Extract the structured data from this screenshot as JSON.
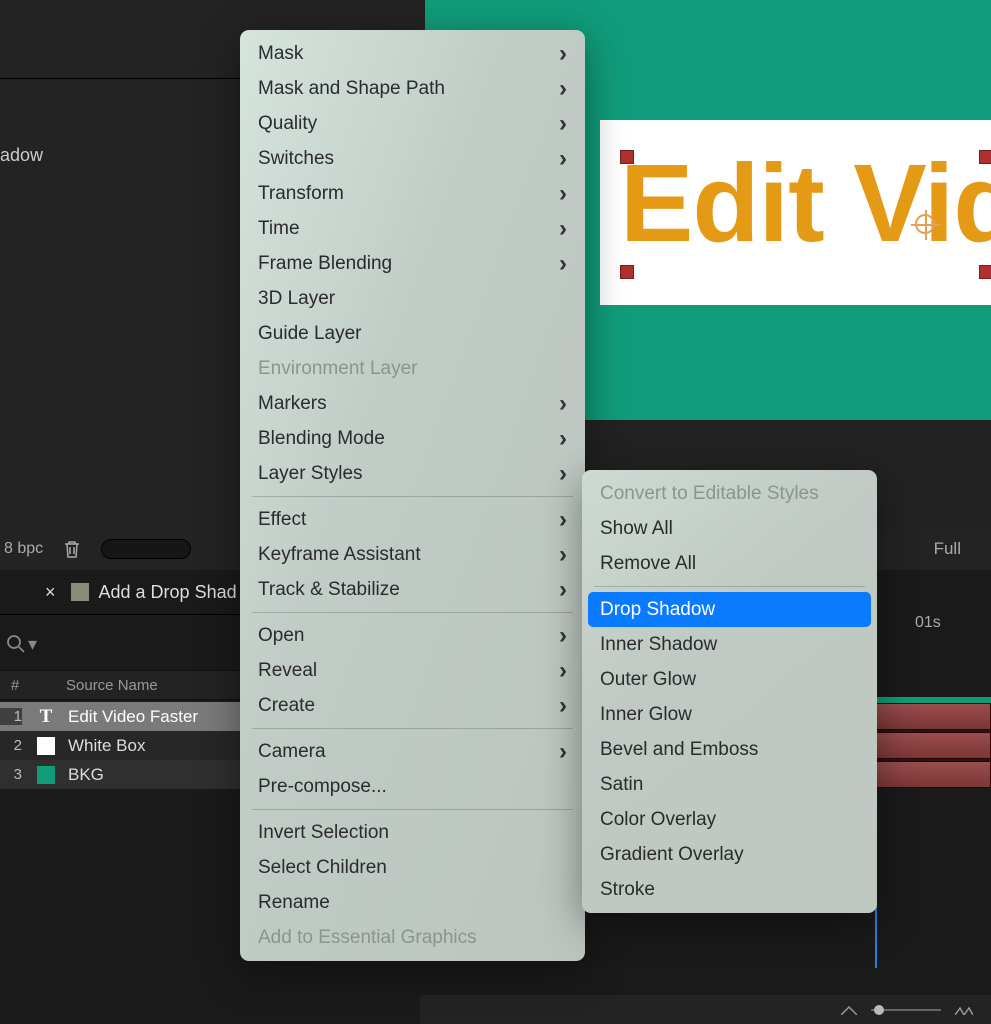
{
  "top": {
    "shadow_text": "adow"
  },
  "project": {
    "bpc": "8 bpc"
  },
  "tab": {
    "title": "Add a Drop Shad"
  },
  "columns": {
    "num": "#",
    "name": "Source Name"
  },
  "layers": [
    {
      "num": "1",
      "type": "text",
      "label": "Edit Video Faster"
    },
    {
      "num": "2",
      "type": "solid",
      "color": "#ffffff",
      "label": "White Box"
    },
    {
      "num": "3",
      "type": "solid",
      "color": "#109c7a",
      "label": "BKG"
    }
  ],
  "preview": {
    "text": "Edit Video",
    "resolution": "Full"
  },
  "timeline": {
    "time_marker": "01s"
  },
  "menu_main": [
    [
      {
        "label": "Mask",
        "sub": true
      },
      {
        "label": "Mask and Shape Path",
        "sub": true
      },
      {
        "label": "Quality",
        "sub": true
      },
      {
        "label": "Switches",
        "sub": true
      },
      {
        "label": "Transform",
        "sub": true
      },
      {
        "label": "Time",
        "sub": true
      },
      {
        "label": "Frame Blending",
        "sub": true
      },
      {
        "label": "3D Layer"
      },
      {
        "label": "Guide Layer"
      },
      {
        "label": "Environment Layer",
        "disabled": true
      },
      {
        "label": "Markers",
        "sub": true
      },
      {
        "label": "Blending Mode",
        "sub": true
      },
      {
        "label": "Layer Styles",
        "sub": true
      }
    ],
    [
      {
        "label": "Effect",
        "sub": true
      },
      {
        "label": "Keyframe Assistant",
        "sub": true
      },
      {
        "label": "Track & Stabilize",
        "sub": true
      }
    ],
    [
      {
        "label": "Open",
        "sub": true
      },
      {
        "label": "Reveal",
        "sub": true
      },
      {
        "label": "Create",
        "sub": true
      }
    ],
    [
      {
        "label": "Camera",
        "sub": true
      },
      {
        "label": "Pre-compose..."
      }
    ],
    [
      {
        "label": "Invert Selection"
      },
      {
        "label": "Select Children"
      },
      {
        "label": "Rename"
      },
      {
        "label": "Add to Essential Graphics",
        "disabled": true
      }
    ]
  ],
  "menu_sub": [
    [
      {
        "label": "Convert to Editable Styles",
        "disabled": true
      },
      {
        "label": "Show All"
      },
      {
        "label": "Remove All"
      }
    ],
    [
      {
        "label": "Drop Shadow",
        "highlight": true
      },
      {
        "label": "Inner Shadow"
      },
      {
        "label": "Outer Glow"
      },
      {
        "label": "Inner Glow"
      },
      {
        "label": "Bevel and Emboss"
      },
      {
        "label": "Satin"
      },
      {
        "label": "Color Overlay"
      },
      {
        "label": "Gradient Overlay"
      },
      {
        "label": "Stroke"
      }
    ]
  ]
}
